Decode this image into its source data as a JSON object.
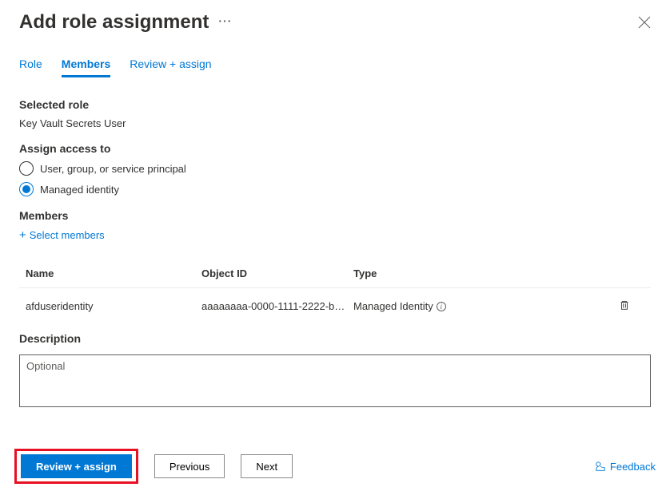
{
  "header": {
    "title": "Add role assignment",
    "ellipsis": "···"
  },
  "tabs": {
    "role": "Role",
    "members": "Members",
    "review": "Review + assign"
  },
  "selectedRole": {
    "label": "Selected role",
    "value": "Key Vault Secrets User"
  },
  "assignAccess": {
    "label": "Assign access to",
    "option1": "User, group, or service principal",
    "option2": "Managed identity"
  },
  "members": {
    "label": "Members",
    "selectLink": "Select members",
    "columns": {
      "name": "Name",
      "objectId": "Object ID",
      "type": "Type"
    },
    "rows": [
      {
        "name": "afduseridentity",
        "objectId": "aaaaaaaa-0000-1111-2222-bb…",
        "type": "Managed Identity"
      }
    ]
  },
  "description": {
    "label": "Description",
    "placeholder": "Optional"
  },
  "footer": {
    "review": "Review + assign",
    "previous": "Previous",
    "next": "Next",
    "feedback": "Feedback"
  }
}
